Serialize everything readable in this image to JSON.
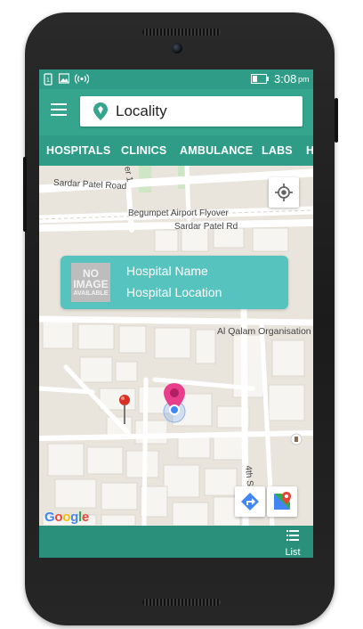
{
  "status_bar": {
    "time": "3:08",
    "period": "pm",
    "icons": [
      "sim-icon",
      "image-icon",
      "broadcast-icon",
      "battery-icon"
    ]
  },
  "toolbar": {
    "menu_icon": "hamburger-menu-icon",
    "search": {
      "value": "Locality",
      "icon": "location-pin-icon"
    }
  },
  "tabs": [
    {
      "label": "HOSPITALS"
    },
    {
      "label": "CLINICS"
    },
    {
      "label": "AMBULANCE"
    },
    {
      "label": "LABS"
    },
    {
      "label": "H"
    }
  ],
  "map": {
    "road_labels": {
      "sardar_patel_road": "Sardar Patel Road",
      "begumpet_flyover": "Begumpet Airport Flyover",
      "sardar_patel_rd": "Sardar Patel Rd",
      "street_1": "er 1",
      "street_4th": "4th St",
      "al_qalam": "Al Qalam Organisation"
    },
    "info_card": {
      "no_image_line1": "NO",
      "no_image_line2": "IMAGE",
      "no_image_line3": "AVAILABLE",
      "name": "Hospital Name",
      "location": "Hospital Location"
    },
    "google_logo": {
      "letters": [
        "G",
        "o",
        "o",
        "g",
        "l",
        "e"
      ],
      "colors": [
        "#4285F4",
        "#EA4335",
        "#FBBC05",
        "#4285F4",
        "#34A853",
        "#EA4335"
      ]
    }
  },
  "bottom_bar": {
    "list_label": "List"
  },
  "colors": {
    "primary": "#35a58e",
    "primary_dark": "#2f9c87",
    "card": "#57c3bf",
    "pin_pink": "#e83e8c"
  }
}
